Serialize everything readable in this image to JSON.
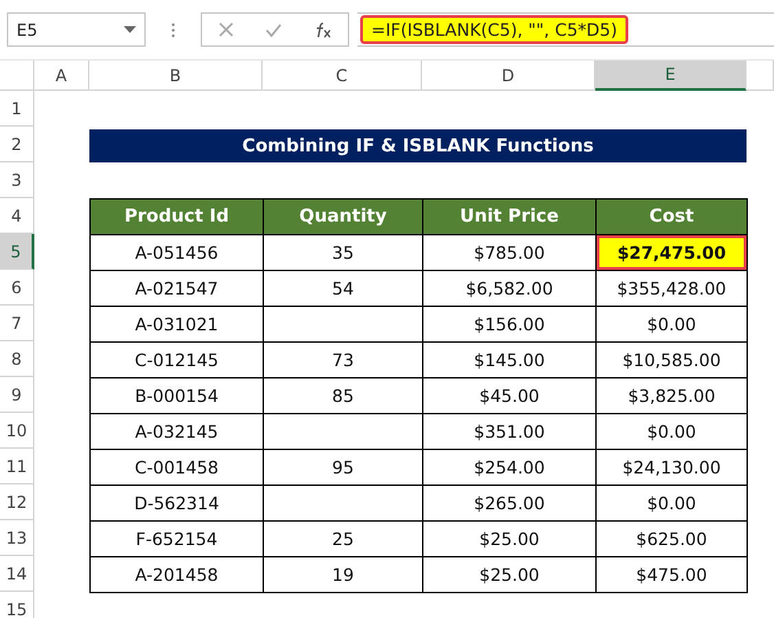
{
  "name_box": "E5",
  "formula": "=IF(ISBLANK(C5), \"\", C5*D5)",
  "columns": [
    {
      "label": "A",
      "selected": false
    },
    {
      "label": "B",
      "selected": false
    },
    {
      "label": "C",
      "selected": false
    },
    {
      "label": "D",
      "selected": false
    },
    {
      "label": "E",
      "selected": true
    }
  ],
  "rows": [
    {
      "label": "1",
      "selected": false
    },
    {
      "label": "2",
      "selected": false
    },
    {
      "label": "3",
      "selected": false
    },
    {
      "label": "4",
      "selected": false
    },
    {
      "label": "5",
      "selected": true
    },
    {
      "label": "6",
      "selected": false
    },
    {
      "label": "7",
      "selected": false
    },
    {
      "label": "8",
      "selected": false
    },
    {
      "label": "9",
      "selected": false
    },
    {
      "label": "10",
      "selected": false
    },
    {
      "label": "11",
      "selected": false
    },
    {
      "label": "12",
      "selected": false
    },
    {
      "label": "13",
      "selected": false
    },
    {
      "label": "14",
      "selected": false
    },
    {
      "label": "15",
      "selected": false
    }
  ],
  "title": "Combining IF & ISBLANK Functions",
  "table": {
    "columns": [
      "Product Id",
      "Quantity",
      "Unit Price",
      "Cost"
    ],
    "rows": [
      {
        "cells": [
          {
            "text": "A-051456",
            "selected": false
          },
          {
            "text": "35",
            "selected": false
          },
          {
            "text": "$785.00",
            "selected": false
          },
          {
            "text": "$27,475.00",
            "selected": true
          }
        ]
      },
      {
        "cells": [
          {
            "text": "A-021547",
            "selected": false
          },
          {
            "text": "54",
            "selected": false
          },
          {
            "text": "$6,582.00",
            "selected": false
          },
          {
            "text": "$355,428.00",
            "selected": false
          }
        ]
      },
      {
        "cells": [
          {
            "text": "A-031021",
            "selected": false
          },
          {
            "selected": false
          },
          {
            "text": "$156.00",
            "selected": false
          },
          {
            "text": "$0.00",
            "selected": false
          }
        ]
      },
      {
        "cells": [
          {
            "text": "C-012145",
            "selected": false
          },
          {
            "text": "73",
            "selected": false
          },
          {
            "text": "$145.00",
            "selected": false
          },
          {
            "text": "$10,585.00",
            "selected": false
          }
        ]
      },
      {
        "cells": [
          {
            "text": "B-000154",
            "selected": false
          },
          {
            "text": "85",
            "selected": false
          },
          {
            "text": "$45.00",
            "selected": false
          },
          {
            "text": "$3,825.00",
            "selected": false
          }
        ]
      },
      {
        "cells": [
          {
            "text": "A-032145",
            "selected": false
          },
          {
            "selected": false
          },
          {
            "text": "$351.00",
            "selected": false
          },
          {
            "text": "$0.00",
            "selected": false
          }
        ]
      },
      {
        "cells": [
          {
            "text": "C-001458",
            "selected": false
          },
          {
            "text": "95",
            "selected": false
          },
          {
            "text": "$254.00",
            "selected": false
          },
          {
            "text": "$24,130.00",
            "selected": false
          }
        ]
      },
      {
        "cells": [
          {
            "text": "D-562314",
            "selected": false
          },
          {
            "selected": false
          },
          {
            "text": "$265.00",
            "selected": false
          },
          {
            "text": "$0.00",
            "selected": false
          }
        ]
      },
      {
        "cells": [
          {
            "text": "F-652154",
            "selected": false
          },
          {
            "text": "25",
            "selected": false
          },
          {
            "text": "$25.00",
            "selected": false
          },
          {
            "text": "$625.00",
            "selected": false
          }
        ]
      },
      {
        "cells": [
          {
            "text": "A-201458",
            "selected": false
          },
          {
            "text": "19",
            "selected": false
          },
          {
            "text": "$25.00",
            "selected": false
          },
          {
            "text": "$475.00",
            "selected": false
          }
        ]
      }
    ]
  }
}
